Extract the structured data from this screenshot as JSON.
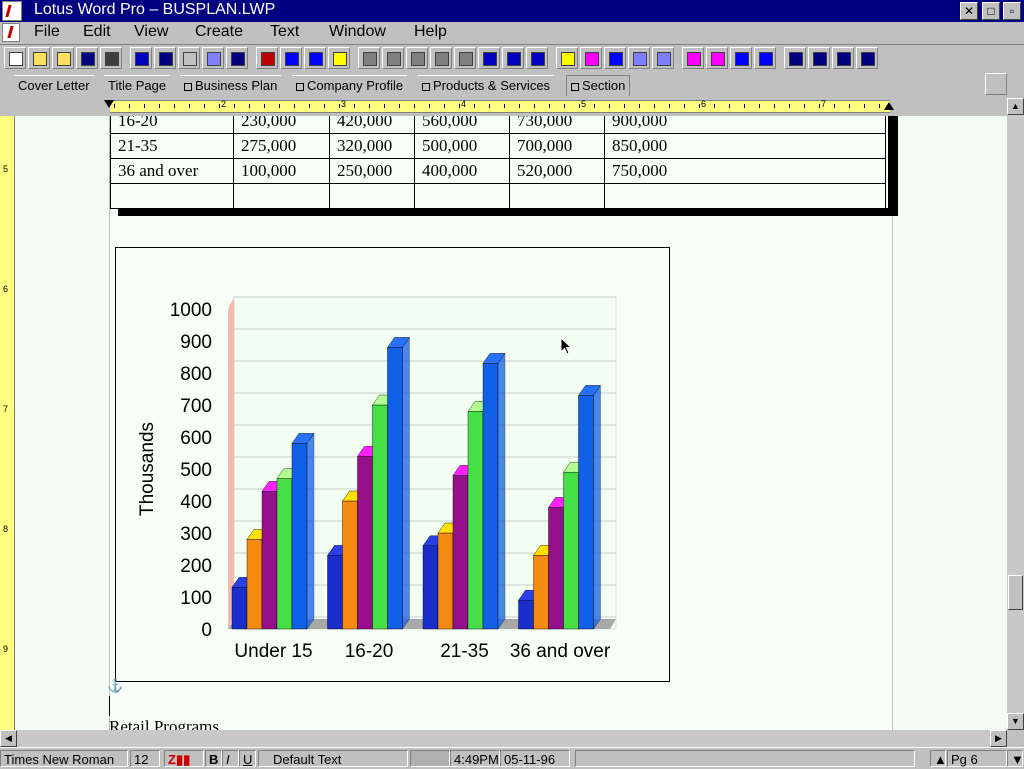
{
  "window": {
    "title": "Lotus Word Pro – BUSPLAN.LWP",
    "close_glyph": "✕",
    "restore_glyph": "□",
    "minimize_glyph": "▫"
  },
  "menu": [
    "File",
    "Edit",
    "View",
    "Create",
    "Text",
    "Window",
    "Help"
  ],
  "toolbar_icons": [
    "new-doc-icon",
    "open-icon",
    "open-folder-icon",
    "print-icon",
    "print-preview-icon",
    "undo-icon",
    "cut-icon",
    "copy-icon",
    "paste-icon",
    "spell-check-icon",
    "frame-icon",
    "table-icon",
    "abc-icon",
    "insert-frame-icon",
    "bold-style-icon",
    "italic-style-icon",
    "underline-style-icon",
    "bullet-icon",
    "numbering-icon",
    "indent-icon",
    "outdent-icon",
    "list-icon",
    "chart-icon",
    "picture-icon",
    "draw-icon",
    "link-icon",
    "smart-icon",
    "arrow-down-icon",
    "move-icon",
    "next-icon",
    "pointer-icon",
    "header-icon",
    "layout-icon",
    "page-icon",
    "paragraph-icon"
  ],
  "tabs": [
    {
      "label": "Cover Letter",
      "active": false
    },
    {
      "label": "Title Page",
      "active": false
    },
    {
      "label": "Business Plan",
      "active": false
    },
    {
      "label": "Company Profile",
      "active": false
    },
    {
      "label": "Products & Services",
      "active": false
    },
    {
      "label": "Section",
      "active": true
    }
  ],
  "ruler": {
    "h_numbers": [
      "2",
      "3",
      "4",
      "5",
      "6",
      "7"
    ],
    "v_numbers": [
      "5",
      "6",
      "7",
      "8",
      "9"
    ]
  },
  "table": {
    "rows": [
      [
        "16-20",
        "230,000",
        "420,000",
        "560,000",
        "730,000",
        "900,000"
      ],
      [
        "21-35",
        "275,000",
        "320,000",
        "500,000",
        "700,000",
        "850,000"
      ],
      [
        "36 and over",
        "100,000",
        "250,000",
        "400,000",
        "520,000",
        "750,000"
      ],
      [
        "",
        "",
        "",
        "",
        "",
        ""
      ]
    ]
  },
  "chart_data": {
    "type": "bar",
    "ylabel": "Thousands",
    "ylim": [
      0,
      1000
    ],
    "yticks": [
      "0",
      "100",
      "200",
      "300",
      "400",
      "500",
      "600",
      "700",
      "800",
      "900",
      "1000"
    ],
    "categories": [
      "Under 15",
      "16-20",
      "21-35",
      "36 and over"
    ],
    "series": [
      {
        "color": "#1a2ecc",
        "values": [
          130,
          230,
          260,
          90
        ]
      },
      {
        "color": "#f58a10",
        "values": [
          280,
          400,
          300,
          230
        ]
      },
      {
        "color": "#96108c",
        "values": [
          430,
          540,
          480,
          380
        ]
      },
      {
        "color": "#44e046",
        "values": [
          470,
          700,
          680,
          490
        ]
      },
      {
        "color": "#1060e8",
        "values": [
          580,
          880,
          830,
          730
        ]
      }
    ],
    "top_colors": [
      "#2840e8",
      "#ffe000",
      "#ff20ff",
      "#b0ff90",
      "#2870ff"
    ]
  },
  "body_text": "Retail Programs",
  "status": {
    "font": "Times New Roman",
    "size": "12",
    "bold": "B",
    "italic": "I",
    "underline": "U",
    "style": "Default Text",
    "time": "4:49PM",
    "date": "05-11-96",
    "page": "Pg 6"
  }
}
